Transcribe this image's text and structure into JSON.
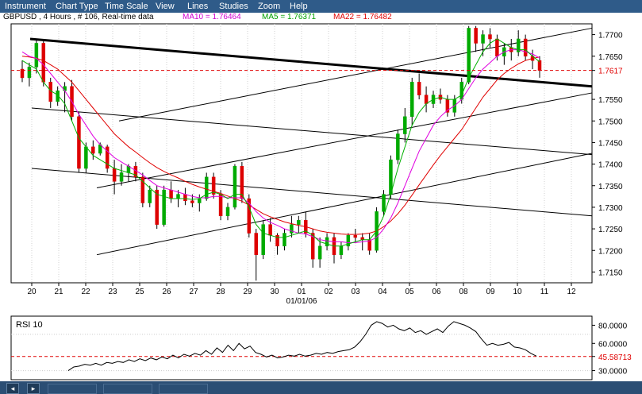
{
  "menu": {
    "items": [
      "Instrument",
      "Chart Type",
      "Time Scale",
      "View",
      "Lines",
      "Studies",
      "Zoom",
      "Help"
    ]
  },
  "title": {
    "symbol": "GBPUSD , 4 Hours , # 106, Real-time data",
    "ma10": "MA10 = 1.76464",
    "ma5": "MA5 = 1.76371",
    "ma22": "MA22 = 1.76482"
  },
  "colors": {
    "up_candle": "#00aa00",
    "down_candle": "#dd0000",
    "ma5": "#00b000",
    "ma10": "#e000e0",
    "ma22": "#e00000",
    "current_line": "#e00000",
    "trendline": "#000000"
  },
  "chart_data": [
    {
      "type": "candlestick",
      "title": "",
      "ylim": [
        1.7125,
        1.7725
      ],
      "y_ticks": [
        "1.7700",
        "1.7650",
        "1.7617",
        "1.7550",
        "1.7500",
        "1.7450",
        "1.7400",
        "1.7350",
        "1.7300",
        "1.7250",
        "1.7200",
        "1.7150"
      ],
      "current_price": "1.7617",
      "x_tick_labels": [
        "20",
        "21",
        "22",
        "23",
        "25",
        "26",
        "27",
        "28",
        "29",
        "30",
        "01",
        "02",
        "03",
        "04",
        "05",
        "06",
        "08",
        "09",
        "10",
        "11",
        "12"
      ],
      "x_sub_label": "01/01/06",
      "candles": [
        [
          1.762,
          1.764,
          1.759,
          1.76
        ],
        [
          1.76,
          1.7635,
          1.758,
          1.7625
        ],
        [
          1.7625,
          1.769,
          1.761,
          1.768
        ],
        [
          1.768,
          1.7685,
          1.758,
          1.759
        ],
        [
          1.759,
          1.76,
          1.753,
          1.7545
        ],
        [
          1.7545,
          1.758,
          1.7535,
          1.757
        ],
        [
          1.757,
          1.759,
          1.752,
          1.758
        ],
        [
          1.758,
          1.7595,
          1.75,
          1.751
        ],
        [
          1.751,
          1.752,
          1.738,
          1.739
        ],
        [
          1.739,
          1.745,
          1.738,
          1.744
        ],
        [
          1.744,
          1.7455,
          1.741,
          1.7425
        ],
        [
          1.7425,
          1.745,
          1.742,
          1.7445
        ],
        [
          1.744,
          1.7445,
          1.738,
          1.739
        ],
        [
          1.739,
          1.741,
          1.733,
          1.736
        ],
        [
          1.736,
          1.74,
          1.735,
          1.738
        ],
        [
          1.738,
          1.74,
          1.736,
          1.7395
        ],
        [
          1.7395,
          1.7405,
          1.736,
          1.737
        ],
        [
          1.737,
          1.738,
          1.73,
          1.731
        ],
        [
          1.731,
          1.735,
          1.73,
          1.734
        ],
        [
          1.734,
          1.735,
          1.725,
          1.726
        ],
        [
          1.726,
          1.735,
          1.7255,
          1.734
        ],
        [
          1.734,
          1.736,
          1.731,
          1.732
        ],
        [
          1.732,
          1.734,
          1.73,
          1.733
        ],
        [
          1.733,
          1.7345,
          1.7305,
          1.7315
        ],
        [
          1.7315,
          1.733,
          1.73,
          1.731
        ],
        [
          1.731,
          1.733,
          1.729,
          1.732
        ],
        [
          1.732,
          1.738,
          1.7315,
          1.737
        ],
        [
          1.737,
          1.738,
          1.732,
          1.733
        ],
        [
          1.733,
          1.734,
          1.727,
          1.728
        ],
        [
          1.728,
          1.731,
          1.727,
          1.73
        ],
        [
          1.73,
          1.74,
          1.7295,
          1.7395
        ],
        [
          1.7395,
          1.7405,
          1.731,
          1.732
        ],
        [
          1.732,
          1.733,
          1.723,
          1.724
        ],
        [
          1.724,
          1.725,
          1.713,
          1.719
        ],
        [
          1.719,
          1.727,
          1.718,
          1.726
        ],
        [
          1.726,
          1.7275,
          1.722,
          1.7235
        ],
        [
          1.7235,
          1.724,
          1.719,
          1.721
        ],
        [
          1.721,
          1.725,
          1.72,
          1.724
        ],
        [
          1.724,
          1.728,
          1.723,
          1.726
        ],
        [
          1.726,
          1.728,
          1.724,
          1.727
        ],
        [
          1.727,
          1.729,
          1.723,
          1.724
        ],
        [
          1.724,
          1.725,
          1.716,
          1.718
        ],
        [
          1.718,
          1.723,
          1.716,
          1.721
        ],
        [
          1.721,
          1.724,
          1.72,
          1.723
        ],
        [
          1.723,
          1.724,
          1.717,
          1.719
        ],
        [
          1.719,
          1.722,
          1.718,
          1.721
        ],
        [
          1.721,
          1.724,
          1.72,
          1.7235
        ],
        [
          1.7235,
          1.725,
          1.722,
          1.723
        ],
        [
          1.723,
          1.724,
          1.72,
          1.7225
        ],
        [
          1.7225,
          1.724,
          1.719,
          1.72
        ],
        [
          1.72,
          1.73,
          1.7195,
          1.729
        ],
        [
          1.729,
          1.734,
          1.728,
          1.733
        ],
        [
          1.733,
          1.742,
          1.732,
          1.741
        ],
        [
          1.741,
          1.748,
          1.74,
          1.747
        ],
        [
          1.747,
          1.753,
          1.745,
          1.751
        ],
        [
          1.751,
          1.76,
          1.749,
          1.759
        ],
        [
          1.759,
          1.761,
          1.755,
          1.756
        ],
        [
          1.756,
          1.758,
          1.752,
          1.754
        ],
        [
          1.754,
          1.757,
          1.753,
          1.756
        ],
        [
          1.756,
          1.7575,
          1.754,
          1.755
        ],
        [
          1.755,
          1.756,
          1.751,
          1.752
        ],
        [
          1.752,
          1.756,
          1.751,
          1.755
        ],
        [
          1.755,
          1.76,
          1.754,
          1.759
        ],
        [
          1.759,
          1.772,
          1.7585,
          1.7715
        ],
        [
          1.7715,
          1.772,
          1.766,
          1.768
        ],
        [
          1.768,
          1.771,
          1.765,
          1.77
        ],
        [
          1.77,
          1.7715,
          1.767,
          1.769
        ],
        [
          1.769,
          1.77,
          1.764,
          1.765
        ],
        [
          1.765,
          1.768,
          1.763,
          1.767
        ],
        [
          1.767,
          1.769,
          1.764,
          1.766
        ],
        [
          1.766,
          1.771,
          1.765,
          1.769
        ],
        [
          1.769,
          1.77,
          1.764,
          1.765
        ],
        [
          1.765,
          1.7665,
          1.762,
          1.764
        ],
        [
          1.764,
          1.765,
          1.76,
          1.7617
        ]
      ],
      "ma5": [
        1.764,
        1.763,
        1.762,
        1.759,
        1.757,
        1.756,
        1.754,
        1.75,
        1.746,
        1.744,
        1.742,
        1.741,
        1.74,
        1.739,
        1.7385,
        1.738,
        1.7375,
        1.736,
        1.7345,
        1.733,
        1.7325,
        1.732,
        1.732,
        1.732,
        1.7318,
        1.732,
        1.733,
        1.7335,
        1.733,
        1.732,
        1.733,
        1.733,
        1.73,
        1.726,
        1.724,
        1.7235,
        1.723,
        1.723,
        1.7235,
        1.724,
        1.7245,
        1.7235,
        1.722,
        1.7215,
        1.721,
        1.721,
        1.7215,
        1.722,
        1.7225,
        1.7225,
        1.7245,
        1.728,
        1.733,
        1.739,
        1.744,
        1.749,
        1.752,
        1.754,
        1.755,
        1.7555,
        1.755,
        1.755,
        1.756,
        1.76,
        1.763,
        1.766,
        1.768,
        1.769,
        1.768,
        1.767,
        1.7665,
        1.7665,
        1.765,
        1.7637
      ],
      "ma10": [
        1.766,
        1.765,
        1.7645,
        1.763,
        1.761,
        1.759,
        1.757,
        1.7545,
        1.7515,
        1.749,
        1.7465,
        1.7445,
        1.743,
        1.7415,
        1.7405,
        1.7395,
        1.7385,
        1.7375,
        1.7362,
        1.735,
        1.7345,
        1.734,
        1.7335,
        1.733,
        1.7325,
        1.7322,
        1.7322,
        1.7325,
        1.7325,
        1.7322,
        1.7322,
        1.7322,
        1.731,
        1.729,
        1.7275,
        1.7265,
        1.7258,
        1.725,
        1.7245,
        1.724,
        1.7238,
        1.7232,
        1.7225,
        1.7222,
        1.722,
        1.722,
        1.7218,
        1.7218,
        1.722,
        1.7222,
        1.723,
        1.725,
        1.7275,
        1.731,
        1.735,
        1.739,
        1.743,
        1.746,
        1.749,
        1.751,
        1.7525,
        1.7535,
        1.755,
        1.7575,
        1.76,
        1.762,
        1.7635,
        1.765,
        1.766,
        1.7665,
        1.7665,
        1.766,
        1.7655,
        1.7646
      ],
      "ma22": [
        1.765,
        1.7648,
        1.7645,
        1.764,
        1.763,
        1.762,
        1.7605,
        1.759,
        1.757,
        1.755,
        1.753,
        1.751,
        1.749,
        1.747,
        1.7455,
        1.744,
        1.7428,
        1.7415,
        1.7403,
        1.7392,
        1.7383,
        1.7375,
        1.7368,
        1.736,
        1.7353,
        1.7347,
        1.7342,
        1.7337,
        1.7332,
        1.7326,
        1.732,
        1.7314,
        1.7305,
        1.7295,
        1.7285,
        1.7278,
        1.7272,
        1.7266,
        1.7262,
        1.7258,
        1.7255,
        1.725,
        1.7245,
        1.7242,
        1.724,
        1.7238,
        1.7237,
        1.7237,
        1.7238,
        1.724,
        1.7245,
        1.7255,
        1.7268,
        1.7285,
        1.7305,
        1.7328,
        1.7352,
        1.7375,
        1.7398,
        1.742,
        1.744,
        1.746,
        1.748,
        1.7505,
        1.753,
        1.7555,
        1.7575,
        1.7595,
        1.761,
        1.7622,
        1.7632,
        1.764,
        1.7645,
        1.7648
      ]
    },
    {
      "type": "line",
      "title": "RSI 10",
      "ylim": [
        20,
        90
      ],
      "y_ticks": [
        "80.0000",
        "60.0000",
        "45.58713",
        "30.0000"
      ],
      "current_value": "45.58713",
      "values": [
        30,
        34,
        35,
        37,
        36,
        38,
        36,
        39,
        38,
        40,
        39,
        42,
        40,
        43,
        41,
        44,
        42,
        45,
        43,
        47,
        44,
        48,
        46,
        49,
        47,
        52,
        48,
        55,
        50,
        58,
        52,
        60,
        54,
        57,
        50,
        48,
        45,
        47,
        44,
        45,
        47,
        46,
        48,
        46,
        47,
        49,
        48,
        50,
        49,
        51,
        52,
        53,
        56,
        62,
        70,
        80,
        84,
        82,
        78,
        80,
        76,
        74,
        77,
        72,
        74,
        70,
        73,
        76,
        72,
        79,
        84,
        82,
        80,
        77,
        73,
        65,
        58,
        60,
        58,
        59,
        61,
        56,
        55,
        53,
        49,
        46
      ]
    }
  ],
  "statusbar": {
    "left_button": "◂",
    "right_button": "▸"
  }
}
